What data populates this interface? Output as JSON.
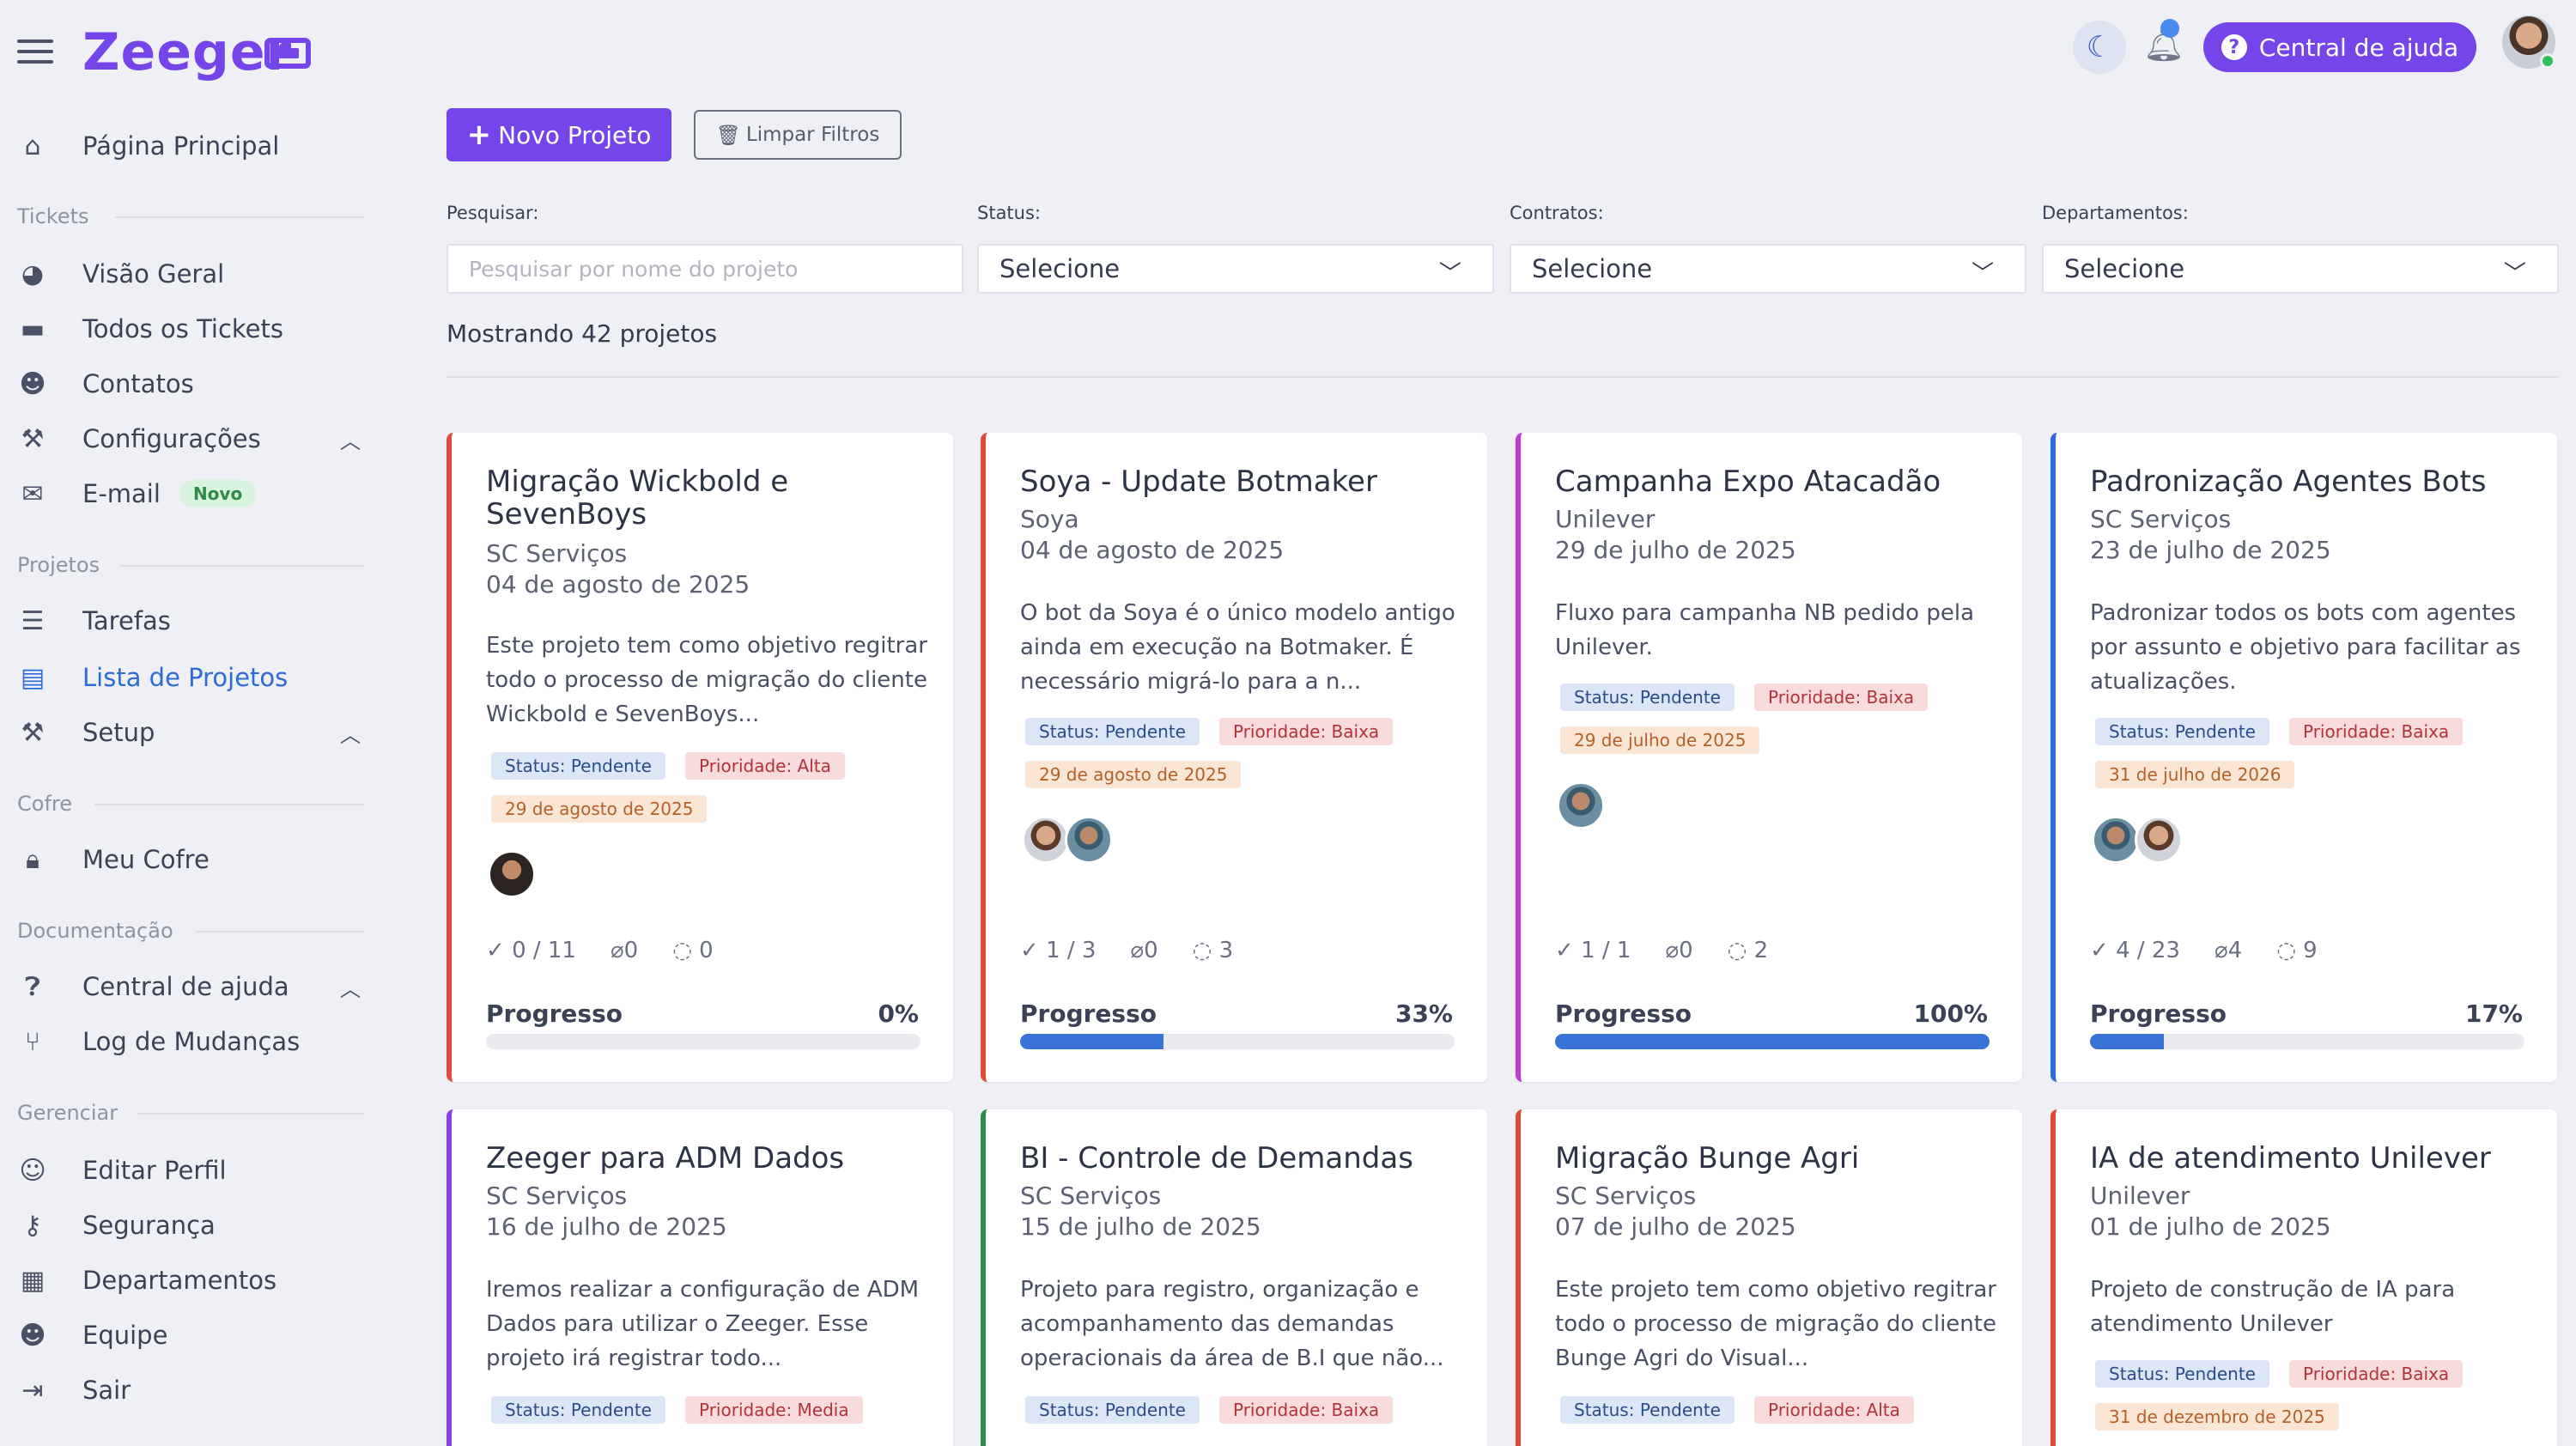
{
  "app": {
    "name": "Zeeger",
    "help_label": "Central de ajuda"
  },
  "sidebar": {
    "home": "Página Principal",
    "sections": {
      "tickets": "Tickets",
      "projetos": "Projetos",
      "cofre": "Cofre",
      "documentacao": "Documentação",
      "gerenciar": "Gerenciar"
    },
    "items": {
      "visao_geral": "Visão Geral",
      "todos_tickets": "Todos os Tickets",
      "contatos": "Contatos",
      "configuracoes": "Configurações",
      "email": "E-mail",
      "email_badge": "Novo",
      "tarefas": "Tarefas",
      "lista_projetos": "Lista de Projetos",
      "setup": "Setup",
      "meu_cofre": "Meu Cofre",
      "central_ajuda": "Central de ajuda",
      "log_mudancas": "Log de Mudanças",
      "editar_perfil": "Editar Perfil",
      "seguranca": "Segurança",
      "departamentos": "Departamentos",
      "equipe": "Equipe",
      "sair": "Sair"
    }
  },
  "toolbar": {
    "new_project": "Novo Projeto",
    "clear_filters": "Limpar Filtros"
  },
  "filters": {
    "search_label": "Pesquisar:",
    "search_placeholder": "Pesquisar por nome do projeto",
    "status_label": "Status:",
    "contracts_label": "Contratos:",
    "departments_label": "Departamentos:",
    "select_value": "Selecione"
  },
  "showing": "Mostrando 42 projetos",
  "progress_label": "Progresso",
  "colors": {
    "accent": "#7445e8",
    "progress": "#3a72d8",
    "red": "#e04a3a",
    "blue": "#2f6bd6",
    "magenta": "#c13bd8",
    "purple": "#8c3fe0",
    "green": "#2e8b4a"
  },
  "projects": [
    {
      "title": "Migração Wickbold e SevenBoys",
      "client": "SC Serviços",
      "date": "04 de agosto de 2025",
      "desc": "Este projeto tem como objetivo regitrar todo o processo de migração do cliente Wickbold e SevenBoys...",
      "status": "Status: Pendente",
      "priority": "Prioridade: Alta",
      "due": "29 de agosto de 2025",
      "tasks": "0 / 11",
      "attachments": "0",
      "comments": "0",
      "progress": "0%",
      "progress_value": 0
    },
    {
      "title": "Soya - Update Botmaker",
      "client": "Soya",
      "date": "04 de agosto de 2025",
      "desc": "O bot da Soya é o único modelo antigo ainda em execução na Botmaker. É necessário migrá-lo para a n...",
      "status": "Status: Pendente",
      "priority": "Prioridade: Baixa",
      "due": "29 de agosto de 2025",
      "tasks": "1 / 3",
      "attachments": "0",
      "comments": "3",
      "progress": "33%",
      "progress_value": 33
    },
    {
      "title": "Campanha Expo Atacadão",
      "client": "Unilever",
      "date": "29 de julho de 2025",
      "desc": "Fluxo para campanha NB pedido pela Unilever.",
      "status": "Status: Pendente",
      "priority": "Prioridade: Baixa",
      "due": "29 de julho de 2025",
      "tasks": "1 / 1",
      "attachments": "0",
      "comments": "2",
      "progress": "100%",
      "progress_value": 100
    },
    {
      "title": "Padronização Agentes Bots",
      "client": "SC Serviços",
      "date": "23 de julho de 2025",
      "desc": "Padronizar todos os bots com agentes por assunto e objetivo para facilitar as atualizações.",
      "status": "Status: Pendente",
      "priority": "Prioridade: Baixa",
      "due": "31 de julho de 2026",
      "tasks": "4 / 23",
      "attachments": "4",
      "comments": "9",
      "progress": "17%",
      "progress_value": 17
    },
    {
      "title": "Zeeger para ADM Dados",
      "client": "SC Serviços",
      "date": "16 de julho de 2025",
      "desc": "Iremos realizar a configuração de ADM Dados para utilizar o Zeeger. Esse projeto irá registrar todo...",
      "status": "Status: Pendente",
      "priority": "Prioridade: Media"
    },
    {
      "title": "BI - Controle de Demandas",
      "client": "SC Serviços",
      "date": "15 de julho de 2025",
      "desc": "Projeto para registro, organização e acompanhamento das demandas operacionais da área de B.I que não...",
      "status": "Status: Pendente",
      "priority": "Prioridade: Baixa"
    },
    {
      "title": "Migração Bunge Agri",
      "client": "SC Serviços",
      "date": "07 de julho de 2025",
      "desc": "Este projeto tem como objetivo regitrar todo o processo de migração do cliente Bunge Agri do Visual...",
      "status": "Status: Pendente",
      "priority": "Prioridade: Alta"
    },
    {
      "title": "IA de atendimento Unilever",
      "client": "Unilever",
      "date": "01 de julho de 2025",
      "desc": "Projeto de construção de IA para atendimento Unilever",
      "status": "Status: Pendente",
      "priority": "Prioridade: Baixa",
      "due": "31 de dezembro de 2025"
    }
  ]
}
